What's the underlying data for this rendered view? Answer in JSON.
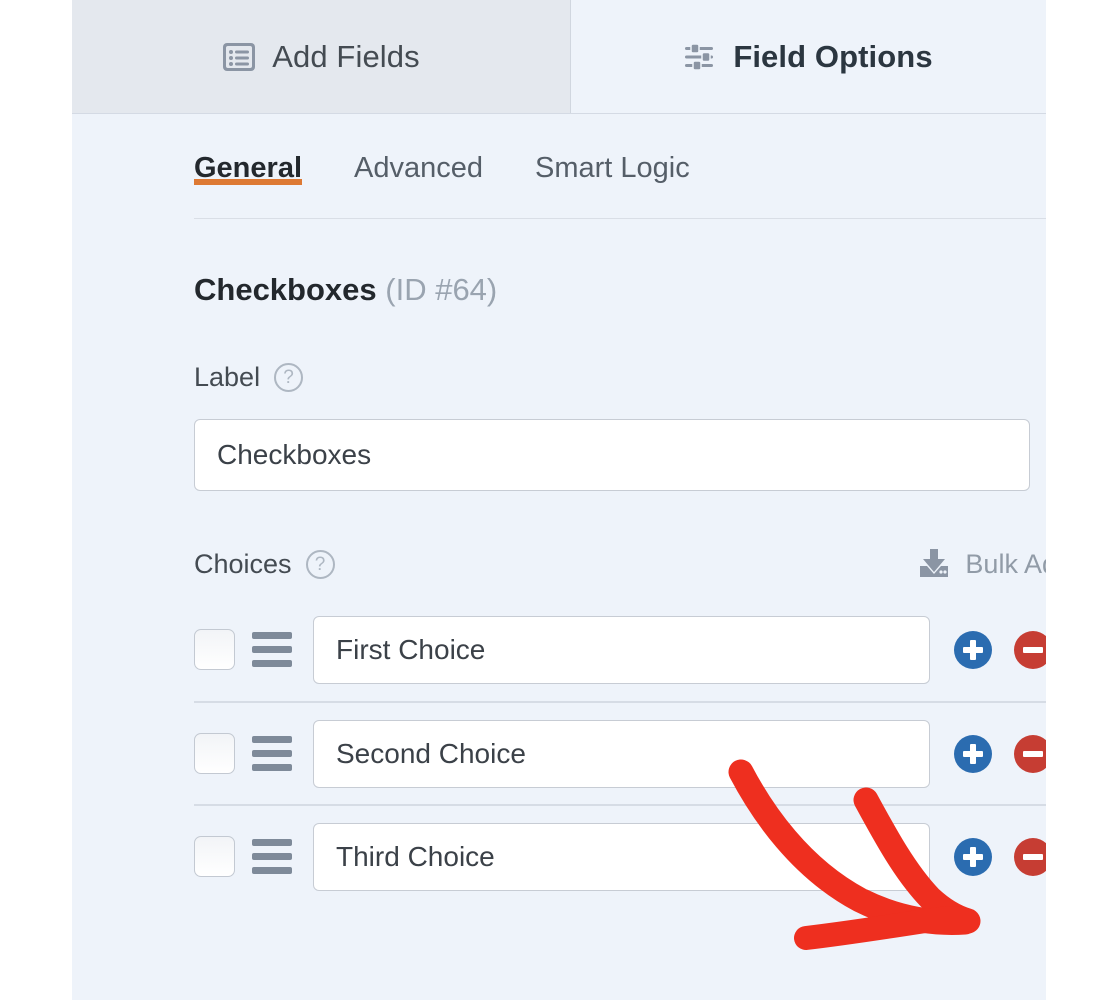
{
  "panel": {
    "tabs": [
      {
        "label": "Add Fields",
        "icon": "form-list-icon",
        "active": false
      },
      {
        "label": "Field Options",
        "icon": "sliders-icon",
        "active": true
      }
    ],
    "sub_tabs": [
      {
        "label": "General",
        "active": true
      },
      {
        "label": "Advanced",
        "active": false
      },
      {
        "label": "Smart Logic",
        "active": false
      }
    ],
    "field_title": "Checkboxes",
    "field_id": "(ID #64)",
    "label_section": {
      "label": "Label",
      "help_icon": "?",
      "value": "Checkboxes",
      "placeholder": ""
    },
    "choices_section": {
      "label": "Choices",
      "help_icon": "?",
      "bulk_add_label": "Bulk Add",
      "bulk_add_icon": "download-icon",
      "rows": [
        {
          "value": "First Choice",
          "checked": false,
          "add_label": "+",
          "remove_label": "-"
        },
        {
          "value": "Second Choice",
          "checked": false,
          "add_label": "+",
          "remove_label": "-"
        },
        {
          "value": "Third Choice",
          "checked": false,
          "add_label": "+",
          "remove_label": "-"
        }
      ]
    }
  },
  "annotation": {
    "type": "hand-drawn-arrow",
    "color": "#ee2f1f",
    "points_to": "remove-button-row-3"
  },
  "colors": {
    "panel_background": "#eef3fa",
    "inactive_tab_background": "#e4e8ee",
    "active_underline": "#dd7933",
    "add_button": "#2b6cb0",
    "remove_button": "#c63d33",
    "annotation": "#ee2f1f"
  }
}
